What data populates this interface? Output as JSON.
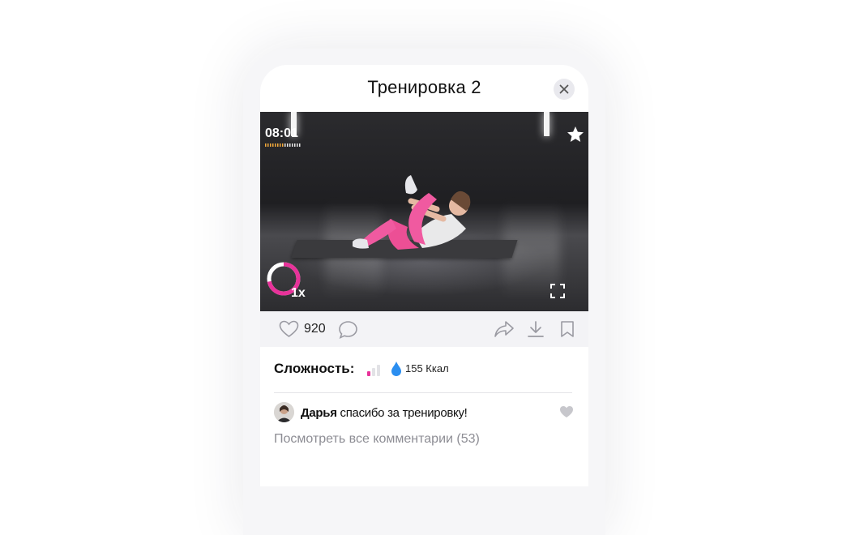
{
  "header": {
    "title": "Тренировка 2",
    "close_icon": "close-icon"
  },
  "video": {
    "timer": "08:01",
    "timer_progress": 0.55,
    "favorite_icon": "star-icon",
    "speed_label": "1x",
    "speed_progress": 0.72,
    "fullscreen_icon": "fullscreen-icon",
    "accent_color": "#e8329a"
  },
  "actions": {
    "likes_count": "920",
    "icons": [
      "heart-icon",
      "comment-icon",
      "share-icon",
      "download-icon",
      "bookmark-icon"
    ]
  },
  "workout_info": {
    "difficulty_label": "Сложность:",
    "difficulty_level": 1,
    "difficulty_max": 3,
    "kcal_text": "155 Ккал",
    "kcal_icon": "drop-icon",
    "kcal_color": "#2b8ef0"
  },
  "comments": {
    "latest": {
      "author": "Дарья",
      "text": " спасибо за тренировку!"
    },
    "view_all_label": "Посмотреть все комментарии (53)"
  }
}
